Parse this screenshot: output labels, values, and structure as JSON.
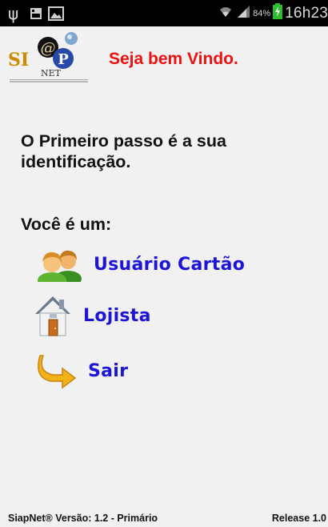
{
  "status_bar": {
    "battery_percent": "84%",
    "time": "16h23",
    "icons": [
      "usb-icon",
      "sd-card-icon",
      "image-icon",
      "wifi-icon",
      "signal-icon",
      "battery-charging-icon"
    ]
  },
  "header": {
    "logo_text": "SIAP",
    "logo_subtext": "NET",
    "welcome": "Seja bem Vindo."
  },
  "content": {
    "intro": "O Primeiro passo é a sua identificação.",
    "question": "Você é um:"
  },
  "menu": {
    "user_label": "Usuário Cartão",
    "shop_label": "Lojista",
    "exit_label": "Sair"
  },
  "footer": {
    "version": "SiapNet® Versão: 1.2 - Primário",
    "release": "Release 1.0"
  },
  "colors": {
    "welcome": "#ee1111",
    "menu_link": "#1c14d6",
    "background": "#f1f1f1",
    "status_bar": "#000000"
  }
}
